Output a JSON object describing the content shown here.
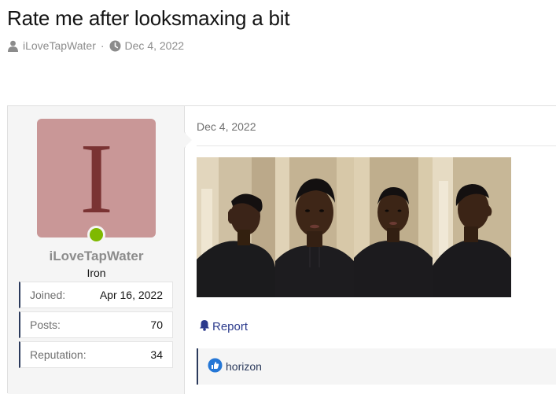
{
  "thread": {
    "title": "Rate me after looksmaxing a bit",
    "author": "iLoveTapWater",
    "separator": "·",
    "date": "Dec 4, 2022"
  },
  "user": {
    "avatar_letter": "I",
    "name": "iLoveTapWater",
    "title": "Iron",
    "online": true,
    "stats": [
      {
        "label": "Joined:",
        "value": "Apr 16, 2022"
      },
      {
        "label": "Posts:",
        "value": "70"
      },
      {
        "label": "Reputation:",
        "value": "34"
      }
    ]
  },
  "post": {
    "date": "Dec 4, 2022",
    "report_label": "Report",
    "reaction_user": "horizon"
  },
  "colors": {
    "accent": "#2b3a5c",
    "avatar_bg": "#c99797",
    "avatar_fg": "#7a3333",
    "online": "#7fb900",
    "like_blue": "#2577d6"
  }
}
